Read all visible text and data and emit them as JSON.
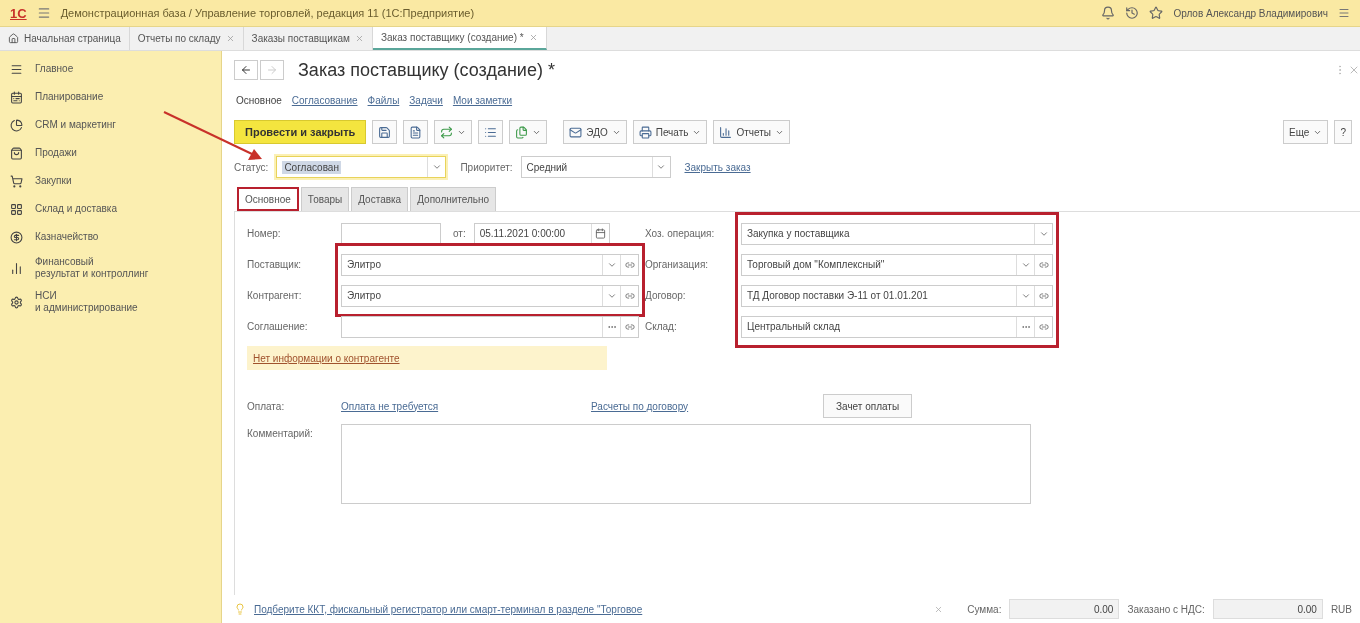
{
  "app": {
    "logo": "1С",
    "title": "Демонстрационная база / Управление торговлей, редакция 11  (1С:Предприятие)",
    "user": "Орлов Александр Владимирович"
  },
  "open_tabs": [
    {
      "label": "Начальная страница",
      "kind": "home",
      "selected": false
    },
    {
      "label": "Отчеты по складу",
      "kind": "closable",
      "selected": false
    },
    {
      "label": "Заказы поставщикам",
      "kind": "closable",
      "selected": false
    },
    {
      "label": "Заказ поставщику (создание) *",
      "kind": "closable",
      "selected": true
    }
  ],
  "sidebar": {
    "items": [
      {
        "label": "Главное"
      },
      {
        "label": "Планирование"
      },
      {
        "label": "CRM и маркетинг"
      },
      {
        "label": "Продажи"
      },
      {
        "label": "Закупки"
      },
      {
        "label": "Склад и доставка"
      },
      {
        "label": "Казначейство"
      },
      {
        "label": "Финансовый\nрезультат и контроллинг"
      },
      {
        "label": "НСИ\nи администрирование"
      }
    ]
  },
  "form": {
    "title": "Заказ поставщику (создание) *",
    "sections": [
      {
        "label": "Основное",
        "selected": true
      },
      {
        "label": "Согласование",
        "selected": false
      },
      {
        "label": "Файлы",
        "selected": false
      },
      {
        "label": "Задачи",
        "selected": false
      },
      {
        "label": "Мои заметки",
        "selected": false
      }
    ],
    "toolbar": [
      {
        "kind": "primary",
        "label": "Провести и закрыть"
      },
      {
        "kind": "icon"
      },
      {
        "kind": "icon"
      },
      {
        "kind": "icon_menu"
      },
      {
        "kind": "icon"
      },
      {
        "kind": "icon_menu"
      },
      {
        "kind": "menu",
        "label": "ЭДО"
      },
      {
        "kind": "menu",
        "label": "Печать"
      },
      {
        "kind": "menu",
        "label": "Отчеты"
      }
    ],
    "more": "Еще",
    "help": "?",
    "status": {
      "label": "Статус:",
      "value": "Согласован",
      "focused": true
    },
    "priority": {
      "label": "Приоритет:",
      "value": "Средний"
    },
    "close_link": "Закрыть заказ",
    "tabs": [
      {
        "label": "Основное",
        "selected": true,
        "highlighted": true
      },
      {
        "label": "Товары",
        "selected": false,
        "highlighted": false
      },
      {
        "label": "Доставка",
        "selected": false,
        "highlighted": false
      },
      {
        "label": "Дополнительно",
        "selected": false,
        "highlighted": false
      }
    ],
    "left_fields": [
      {
        "kind": "number_date",
        "label": "Номер:",
        "date_label": "от:",
        "date": "05.11.2021 0:00:00",
        "highlighted": false
      },
      {
        "kind": "combo",
        "label": "Поставщик:",
        "value": "Элитро",
        "highlighted": true
      },
      {
        "kind": "combo",
        "label": "Контрагент:",
        "value": "Элитро",
        "highlighted": true
      },
      {
        "kind": "choice",
        "label": "Соглашение:",
        "highlighted": false
      }
    ],
    "right_fields": [
      {
        "kind": "dropdown",
        "label": "Хоз. операция:",
        "value": "Закупка у поставщика",
        "highlighted": true
      },
      {
        "kind": "combo",
        "label": "Организация:",
        "value": "Торговый дом \"Комплексный\"",
        "highlighted": true
      },
      {
        "kind": "combo",
        "label": "Договор:",
        "value": "ТД Договор поставки Э-11 от 01.01.201",
        "highlighted": true
      },
      {
        "kind": "choice",
        "label": "Склад:",
        "value": "Центральный склад",
        "highlighted": true
      }
    ],
    "warning": "Нет информации о контрагенте",
    "payment": {
      "label": "Оплата:",
      "link": "Оплата не требуется",
      "contract_link": "Расчеты по договору",
      "button": "Зачет оплаты"
    },
    "comment": {
      "label": "Комментарий:"
    }
  },
  "footer": {
    "hint": "Подберите ККТ, фискальный регистратор или смарт-терминал в разделе \"Торговое",
    "total_label": "Сумма:",
    "total": "0.00",
    "ordered_label": "Заказано с НДС:",
    "ordered": "0.00",
    "currency": "RUB"
  },
  "annotation": {
    "arrow": true
  }
}
